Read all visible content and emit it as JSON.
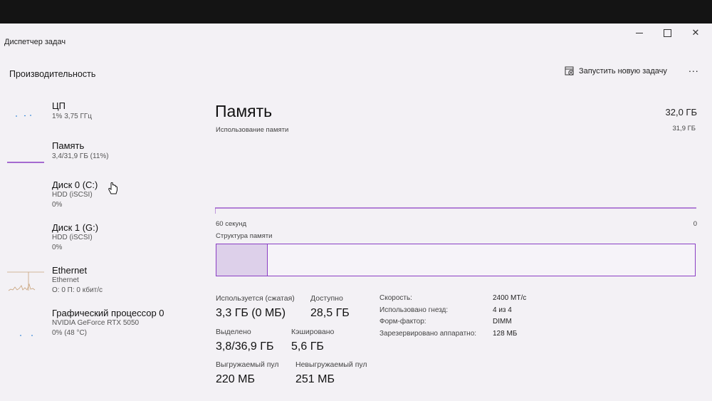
{
  "window": {
    "title": "Диспетчер задач"
  },
  "header": {
    "heading": "Производительность",
    "run_task": "Запустить новую задачу",
    "more": "..."
  },
  "sidebar": {
    "items": [
      {
        "name": "ЦП",
        "line1": "1% 3,75 ГГц",
        "line2": ""
      },
      {
        "name": "Память",
        "line1": "3,4/31,9 ГБ (11%)",
        "line2": ""
      },
      {
        "name": "Диск 0 (C:)",
        "line1": "HDD (iSCSI)",
        "line2": "0%"
      },
      {
        "name": "Диск 1 (G:)",
        "line1": "HDD (iSCSI)",
        "line2": "0%"
      },
      {
        "name": "Ethernet",
        "line1": "Ethernet",
        "line2": "О: 0 П: 0 кбит/с"
      },
      {
        "name": "Графический процессор 0",
        "line1": "NVIDIA GeForce RTX 5050",
        "line2": "0% (48 °C)"
      }
    ]
  },
  "memory": {
    "title": "Память",
    "total": "32,0 ГБ",
    "usage_label": "Использование памяти",
    "usage_max": "31,9 ГБ",
    "graph_left": "60 секунд",
    "graph_right": "0",
    "structure_label": "Структура памяти",
    "used_fraction": 0.106,
    "stats": {
      "in_use_label": "Используется (сжатая)",
      "in_use_value": "3,3 ГБ (0 МБ)",
      "available_label": "Доступно",
      "available_value": "28,5 ГБ",
      "committed_label": "Выделено",
      "committed_value": "3,8/36,9 ГБ",
      "cached_label": "Кэшировано",
      "cached_value": "5,6 ГБ",
      "paged_label": "Выгружаемый пул",
      "paged_value": "220 МБ",
      "nonpaged_label": "Невыгружаемый пул",
      "nonpaged_value": "251 МБ"
    },
    "props": [
      {
        "label": "Скорость:",
        "value": "2400 MT/c"
      },
      {
        "label": "Использовано гнезд:",
        "value": "4 из 4"
      },
      {
        "label": "Форм-фактор:",
        "value": "DIMM"
      },
      {
        "label": "Зарезервировано аппаратно:",
        "value": "128 МБ"
      }
    ]
  },
  "colors": {
    "accent": "#8a3ec4",
    "window_bg": "#f3f1f5"
  }
}
